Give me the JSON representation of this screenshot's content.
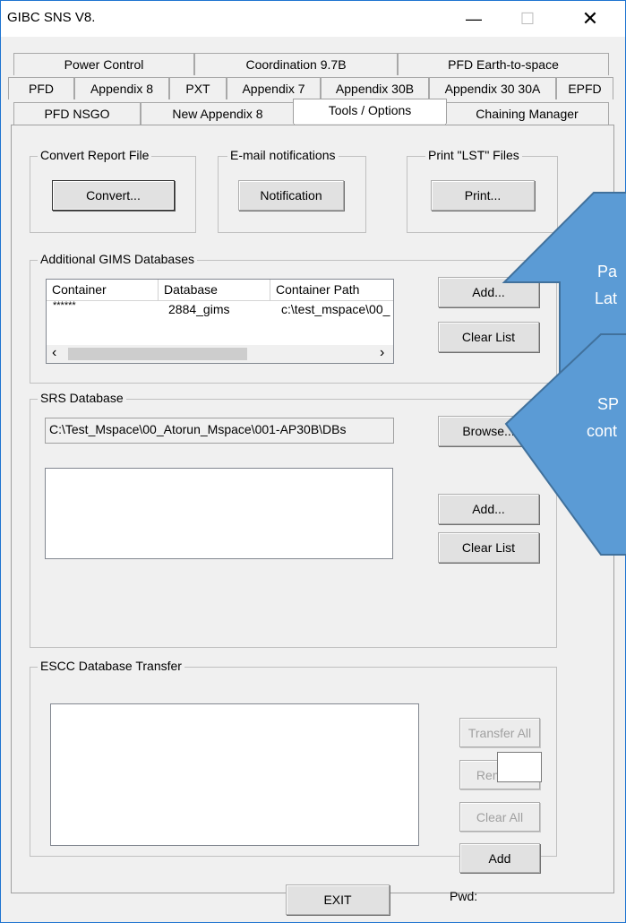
{
  "window": {
    "title": "GIBC SNS V8."
  },
  "tabs": {
    "row1": [
      "Power Control",
      "Coordination 9.7B",
      "PFD Earth-to-space"
    ],
    "row2": [
      "PFD",
      "Appendix 8",
      "PXT",
      "Appendix 7",
      "Appendix 30B",
      "Appendix 30 30A",
      "EPFD"
    ],
    "row3": [
      "PFD NSGO",
      "New Appendix 8",
      "Tools / Options",
      "Chaining Manager"
    ]
  },
  "convert_group": {
    "title": "Convert Report File",
    "button": "Convert..."
  },
  "email_group": {
    "title": "E-mail notifications",
    "button": "Notification"
  },
  "print_group": {
    "title": "Print \"LST\" Files",
    "button": "Print..."
  },
  "gims_group": {
    "title": "Additional GIMS Databases",
    "columns": [
      "Container",
      "Database",
      "Container Path"
    ],
    "rows": [
      [
        "******",
        "2884_gims",
        "c:\\test_mspace\\00_"
      ]
    ],
    "add_button": "Add...",
    "clear_button": "Clear List"
  },
  "srs_group": {
    "title": "SRS Database",
    "path_value": "C:\\Test_Mspace\\00_Atorun_Mspace\\001-AP30B\\DBs",
    "browse_button": "Browse...",
    "add_button": "Add...",
    "clear_button": "Clear List"
  },
  "escc_group": {
    "title": "ESCC Database Transfer",
    "transfer_all": "Transfer All",
    "remove": "Remove",
    "clear_all": "Clear All",
    "add": "Add",
    "pwd_label": "Pwd:"
  },
  "exit_button": "EXIT",
  "callouts": {
    "c1_line1": "Pa",
    "c1_line2": "Lat",
    "c2_line1": "SP",
    "c2_line2": "cont"
  },
  "colors": {
    "callout": "#5b9bd5",
    "callout_border": "#41719c"
  }
}
